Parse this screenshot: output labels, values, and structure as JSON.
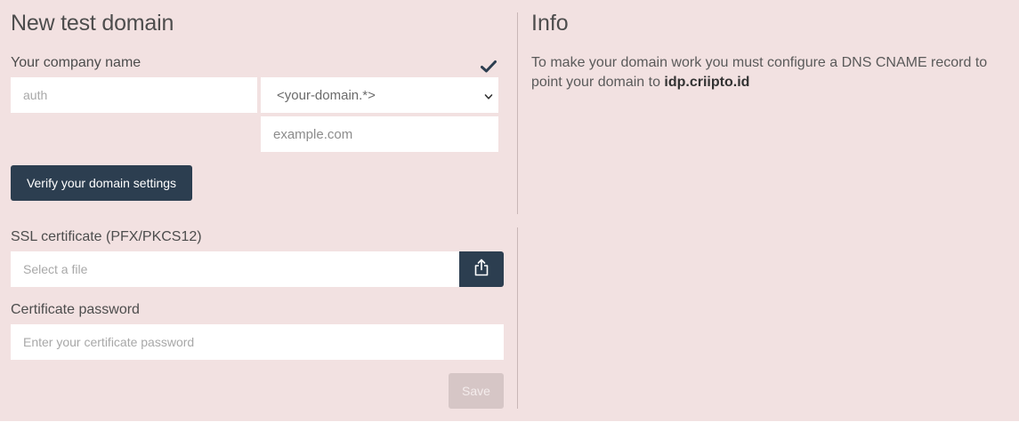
{
  "form": {
    "title": "New test domain",
    "company_label": "Your company name",
    "company_placeholder": "auth",
    "domain_select_value": "<your-domain.*>",
    "domain_placeholder": "example.com",
    "verify_label": "Verify your domain settings",
    "ssl_label": "SSL certificate (PFX/PKCS12)",
    "file_placeholder": "Select a file",
    "password_label": "Certificate password",
    "password_placeholder": "Enter your certificate password",
    "save_label": "Save"
  },
  "info": {
    "title": "Info",
    "text": "To make your domain work you must configure a DNS CNAME record to point your domain to ",
    "host": "idp.criipto.id"
  },
  "icons": {
    "check": "check-icon",
    "chevron": "chevron-down-icon",
    "upload": "share-upload-icon"
  },
  "colors": {
    "background": "#f2e1e1",
    "primary_button": "#2c3e50",
    "disabled_button": "#d6c6c6"
  }
}
